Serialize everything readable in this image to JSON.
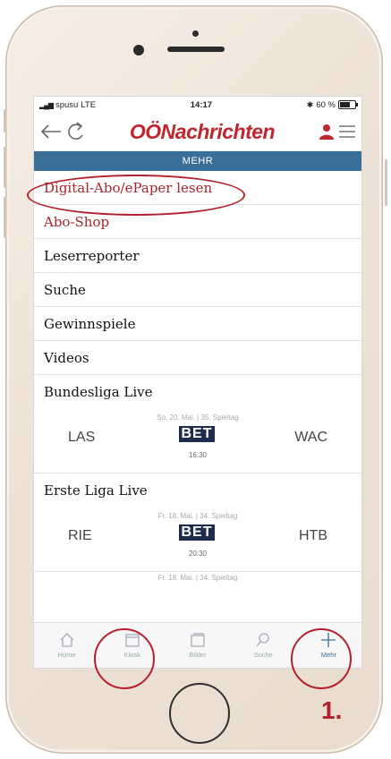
{
  "status": {
    "carrier": "spusu",
    "network": "LTE",
    "time": "14:17",
    "battery": "60 %"
  },
  "app": {
    "logo": "OÖNachrichten"
  },
  "section_title": "MEHR",
  "menu": [
    {
      "label": "Digital-Abo/ePaper lesen"
    },
    {
      "label": "Abo-Shop"
    },
    {
      "label": "Leserreporter"
    },
    {
      "label": "Suche"
    },
    {
      "label": "Gewinnspiele"
    },
    {
      "label": "Videos"
    },
    {
      "label": "Bundesliga Live"
    },
    {
      "label": "Erste Liga Live"
    }
  ],
  "matches": [
    {
      "date": "So. 20. Mai. | 35. Spieltag",
      "home": "LAS",
      "away": "WAC",
      "sponsor": "BET",
      "time": "16:30"
    },
    {
      "date": "Fr. 18. Mai. | 34. Spieltag",
      "home": "RIE",
      "away": "HTB",
      "sponsor": "BET",
      "time": "20:30"
    },
    {
      "date": "Fr. 18. Mai. | 34. Spieltag"
    }
  ],
  "tabs": [
    {
      "label": "Home",
      "icon": "home-icon"
    },
    {
      "label": "Kiosk",
      "icon": "kiosk-icon"
    },
    {
      "label": "Bilder",
      "icon": "images-icon"
    },
    {
      "label": "Suche",
      "icon": "search-icon"
    },
    {
      "label": "Mehr",
      "icon": "plus-icon"
    }
  ],
  "annotation": {
    "step": "1."
  },
  "colors": {
    "brand_red": "#c0262d",
    "nav_blue": "#3a6f99",
    "highlight_red": "#b2202c"
  }
}
